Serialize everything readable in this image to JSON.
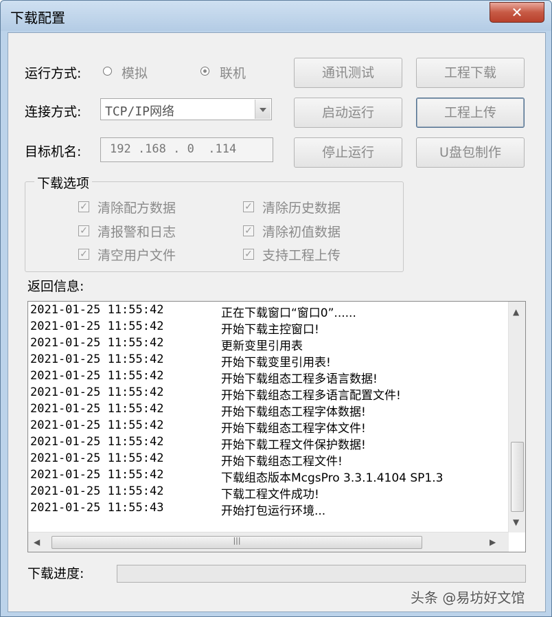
{
  "window": {
    "title": "下载配置",
    "close_label": "✕"
  },
  "run_mode": {
    "label": "运行方式:",
    "options": [
      {
        "label": "模拟",
        "selected": false
      },
      {
        "label": "联机",
        "selected": true
      }
    ]
  },
  "connection": {
    "label": "连接方式:",
    "value": "TCP/IP网络"
  },
  "target": {
    "label": "目标机名:",
    "value": "192 .168 . 0  .114"
  },
  "buttons": {
    "comm_test": "通讯测试",
    "download": "工程下载",
    "start_run": "启动运行",
    "upload": "工程上传",
    "stop_run": "停止运行",
    "usb_make": "U盘包制作"
  },
  "options_group": {
    "title": "下载选项",
    "items": [
      {
        "label": "清除配方数据",
        "checked": true
      },
      {
        "label": "清除历史数据",
        "checked": true
      },
      {
        "label": "清报警和日志",
        "checked": true
      },
      {
        "label": "清除初值数据",
        "checked": true
      },
      {
        "label": "清空用户文件",
        "checked": true
      },
      {
        "label": "支持工程上传",
        "checked": true
      }
    ]
  },
  "log": {
    "label": "返回信息:",
    "rows": [
      {
        "time": "2021-01-25 11:55:42",
        "msg": "正在下载窗口“窗口0”......"
      },
      {
        "time": "2021-01-25 11:55:42",
        "msg": "开始下载主控窗口!"
      },
      {
        "time": "2021-01-25 11:55:42",
        "msg": "更新变里引用表"
      },
      {
        "time": "2021-01-25 11:55:42",
        "msg": "开始下载变里引用表!"
      },
      {
        "time": "2021-01-25 11:55:42",
        "msg": "开始下载组态工程多语言数据!"
      },
      {
        "time": "2021-01-25 11:55:42",
        "msg": "开始下载组态工程多语言配置文件!"
      },
      {
        "time": "2021-01-25 11:55:42",
        "msg": "开始下载组态工程字体数据!"
      },
      {
        "time": "2021-01-25 11:55:42",
        "msg": "开始下载组态工程字体文件!"
      },
      {
        "time": "2021-01-25 11:55:42",
        "msg": "开始下载工程文件保护数据!"
      },
      {
        "time": "2021-01-25 11:55:42",
        "msg": "开始下载组态工程文件!"
      },
      {
        "time": "2021-01-25 11:55:42",
        "msg": "下载组态版本McgsPro 3.3.1.4104 SP1.3"
      },
      {
        "time": "2021-01-25 11:55:42",
        "msg": "下载工程文件成功!"
      },
      {
        "time": "2021-01-25 11:55:43",
        "msg": "开始打包运行环境..."
      }
    ]
  },
  "progress": {
    "label": "下载进度:",
    "value": 0,
    "fill_color": "#37b44a"
  },
  "watermark": "头条 @易坊好文馆"
}
